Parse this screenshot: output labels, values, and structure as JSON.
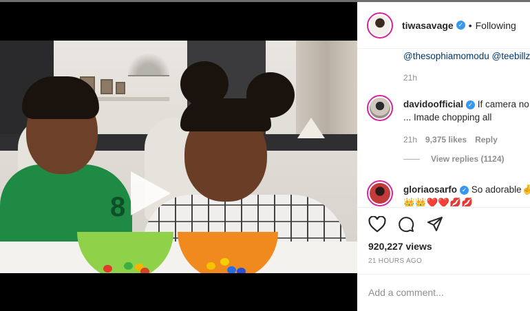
{
  "post": {
    "username": "tiwasavage",
    "follow_label": "Following",
    "dot": "•"
  },
  "comments": {
    "caption_tail": "@thesophiamomodu @teebillz",
    "caption_time": "21h",
    "items": [
      {
        "username": "davidoofficial",
        "text": "If camera no catch ... Imade chopping all",
        "line1": "If camera no",
        "line2": "... Imade chopping all",
        "time": "21h",
        "likes": "9,375 likes",
        "reply_label": "Reply",
        "view_replies": "View replies (1124)"
      },
      {
        "username": "gloriaosarfo",
        "line1": "So adorable",
        "line1_emoji": "🤞",
        "line2": "👑👑❤️❤️💋💋"
      }
    ]
  },
  "actions": {
    "views": "920,227 views",
    "time_ago": "21 HOURS AGO"
  },
  "input": {
    "placeholder": "Add a comment..."
  },
  "icons": [
    "play-icon",
    "verified-icon",
    "heart-icon",
    "comment-icon",
    "share-icon"
  ],
  "colors": {
    "link": "#00376b",
    "verified": "#3897f0",
    "muted": "#8e8e8e",
    "text": "#262626",
    "ring": "#d6249f"
  }
}
